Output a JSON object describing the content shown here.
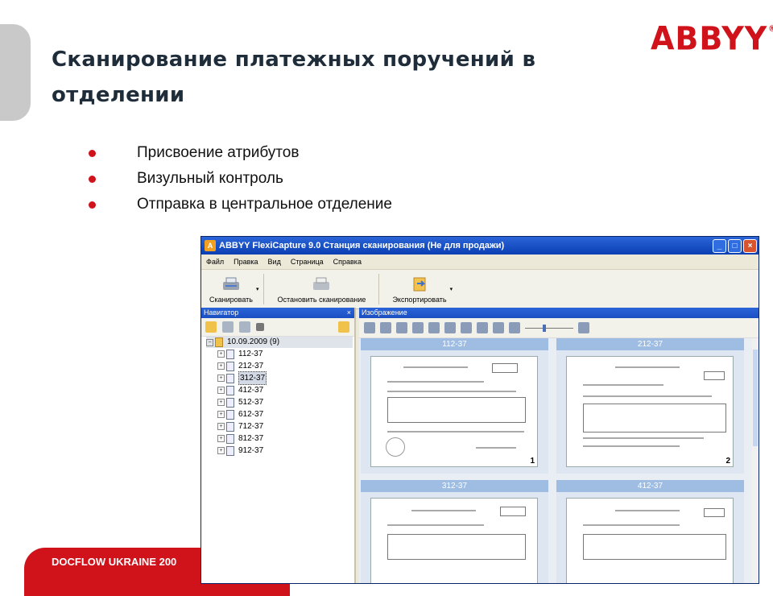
{
  "slide": {
    "title": "Сканирование платежных поручений в отделении",
    "logo": "ABBYY",
    "logo_mark": "®",
    "bullets": [
      "Присвоение атрибутов",
      "Визульный контроль",
      "Отправка в центральное отделение"
    ],
    "footer": "DOCFLOW UKRAINE 200",
    "accent_color": "#d0121b"
  },
  "app": {
    "title": "ABBYY FlexiCapture 9.0 Станция сканирования (Не для продажи)",
    "window_buttons": {
      "minimize": "_",
      "maximize": "□",
      "close": "×"
    },
    "menu": [
      "Файл",
      "Правка",
      "Вид",
      "Страница",
      "Справка"
    ],
    "toolbar": {
      "scan_label": "Сканировать",
      "stop_label": "Остановить сканирование",
      "export_label": "Экспортировать",
      "dropdown_arrow": "▾"
    },
    "navigator": {
      "title": "Навигатор",
      "close": "×",
      "root": "10.09.2009 (9)",
      "items": [
        "112-37",
        "212-37",
        "312-37",
        "412-37",
        "512-37",
        "612-37",
        "712-37",
        "812-37",
        "912-37"
      ],
      "selected": "312-37"
    },
    "image_pane": {
      "title": "Изображение",
      "thumbnails": [
        {
          "label": "112-37",
          "page": "1"
        },
        {
          "label": "212-37",
          "page": "2"
        },
        {
          "label": "312-37",
          "page": ""
        },
        {
          "label": "412-37",
          "page": ""
        }
      ]
    }
  }
}
